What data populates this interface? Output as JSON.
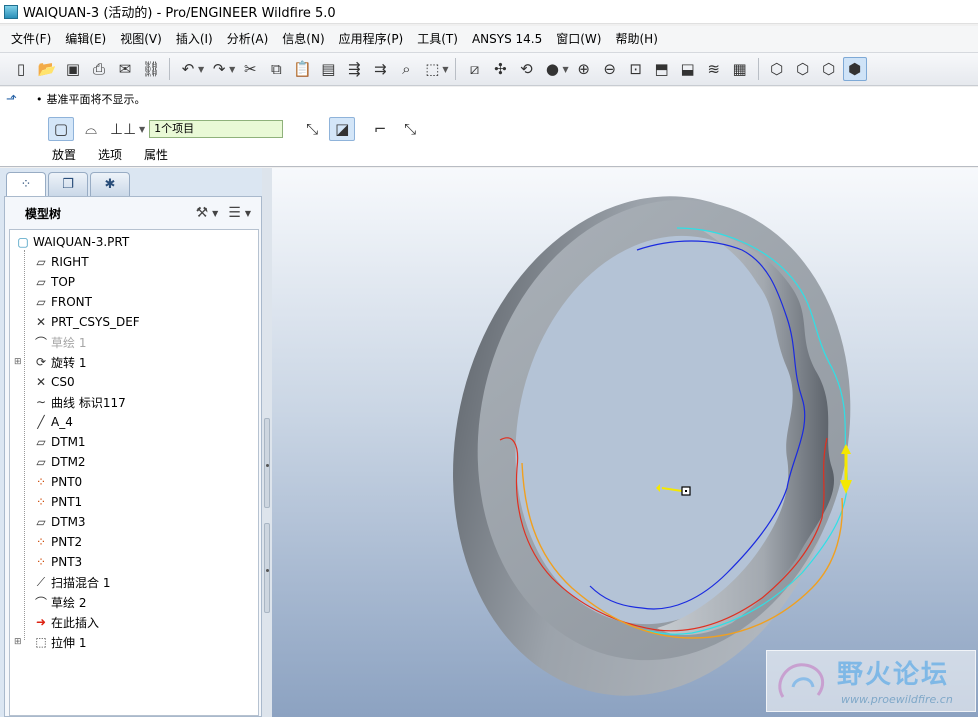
{
  "window": {
    "title": "WAIQUAN-3 (活动的) - Pro/ENGINEER Wildfire 5.0"
  },
  "menubar": {
    "items": [
      "文件(F)",
      "编辑(E)",
      "视图(V)",
      "插入(I)",
      "分析(A)",
      "信息(N)",
      "应用程序(P)",
      "工具(T)",
      "ANSYS 14.5",
      "窗口(W)",
      "帮助(H)"
    ]
  },
  "dashboard": {
    "message": "基准平面将不显示。",
    "selection_field": "1个项目",
    "tabs": [
      "放置",
      "选项",
      "属性"
    ]
  },
  "navigator": {
    "panel_title": "模型树",
    "tree": [
      {
        "label": "WAIQUAN-3.PRT",
        "icon": "part-icon",
        "indent": 0
      },
      {
        "label": "RIGHT",
        "icon": "datum-plane-icon",
        "indent": 1
      },
      {
        "label": "TOP",
        "icon": "datum-plane-icon",
        "indent": 1
      },
      {
        "label": "FRONT",
        "icon": "datum-plane-icon",
        "indent": 1
      },
      {
        "label": "PRT_CSYS_DEF",
        "icon": "csys-icon",
        "indent": 1
      },
      {
        "label": "草绘 1",
        "icon": "sketch-icon",
        "indent": 1,
        "dim": true
      },
      {
        "label": "旋转 1",
        "icon": "revolve-icon",
        "indent": 1,
        "expandable": true
      },
      {
        "label": "CS0",
        "icon": "csys-icon",
        "indent": 1
      },
      {
        "label": "曲线 标识117",
        "icon": "curve-icon",
        "indent": 1
      },
      {
        "label": "A_4",
        "icon": "axis-icon",
        "indent": 1
      },
      {
        "label": "DTM1",
        "icon": "datum-plane-icon",
        "indent": 1
      },
      {
        "label": "DTM2",
        "icon": "datum-plane-icon",
        "indent": 1
      },
      {
        "label": "PNT0",
        "icon": "datum-point-icon",
        "indent": 1
      },
      {
        "label": "PNT1",
        "icon": "datum-point-icon",
        "indent": 1
      },
      {
        "label": "DTM3",
        "icon": "datum-plane-icon",
        "indent": 1
      },
      {
        "label": "PNT2",
        "icon": "datum-point-icon",
        "indent": 1
      },
      {
        "label": "PNT3",
        "icon": "datum-point-icon",
        "indent": 1
      },
      {
        "label": "扫描混合 1",
        "icon": "swept-blend-icon",
        "indent": 1
      },
      {
        "label": "草绘 2",
        "icon": "sketch-icon",
        "indent": 1
      },
      {
        "label": "在此插入",
        "icon": "insert-here-icon",
        "indent": 1
      },
      {
        "label": "拉伸 1",
        "icon": "extrude-icon",
        "indent": 1,
        "expandable": true
      }
    ]
  },
  "watermark": {
    "text_cn": "野火论坛",
    "url": "www.proewildfire.cn"
  }
}
